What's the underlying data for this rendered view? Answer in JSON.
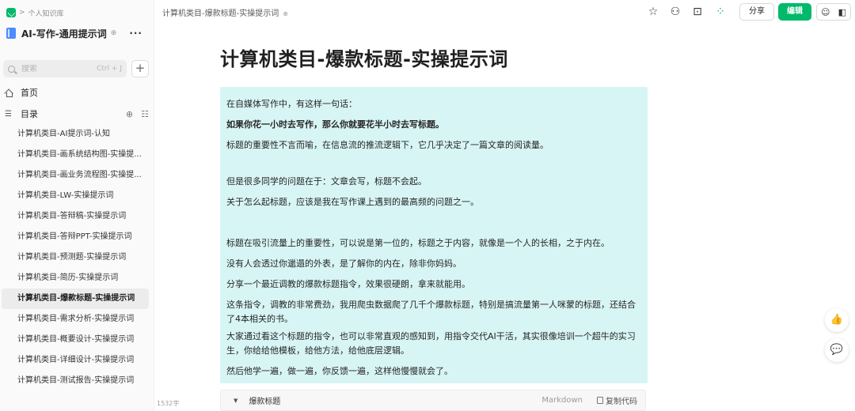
{
  "breadcrumb": {
    "separator": ">",
    "label": "个人知识库"
  },
  "knowledge_base": {
    "title": "AI-写作-通用提示词",
    "share_glyph": "⊕",
    "more_glyph": "···"
  },
  "search": {
    "placeholder": "搜索",
    "shortcut": "Ctrl + J"
  },
  "add_button": {
    "label": "+"
  },
  "nav": {
    "home": "首页",
    "toc": "目录"
  },
  "doc_list": [
    {
      "label": "计算机类目-AI提示词-认知",
      "active": false
    },
    {
      "label": "计算机类目-画系统结构图-实操提...",
      "active": false
    },
    {
      "label": "计算机类目-画业务流程图-实操提...",
      "active": false
    },
    {
      "label": "计算机类目-LW-实操提示词",
      "active": false
    },
    {
      "label": "计算机类目-答辩稿-实操提示词",
      "active": false
    },
    {
      "label": "计算机类目-答辩PPT-实操提示词",
      "active": false
    },
    {
      "label": "计算机类目-预测题-实操提示词",
      "active": false
    },
    {
      "label": "计算机类目-简历-实操提示词",
      "active": false
    },
    {
      "label": "计算机类目-爆款标题-实操提示词",
      "active": true
    },
    {
      "label": "计算机类目-需求分析-实操提示词",
      "active": false
    },
    {
      "label": "计算机类目-概要设计-实操提示词",
      "active": false
    },
    {
      "label": "计算机类目-详细设计-实操提示词",
      "active": false
    },
    {
      "label": "计算机类目-测试报告-实操提示词",
      "active": false
    }
  ],
  "word_count": "1532字",
  "topbar": {
    "doc_title": "计算机类目-爆款标题-实操提示词",
    "share_glyph": "⊕",
    "share_button": "分享",
    "edit_button": "编辑"
  },
  "page": {
    "title": "计算机类目-爆款标题-实操提示词",
    "paragraphs": [
      "在自媒体写作中，有这样一句话：",
      "如果你花一小时去写作，那么你就要花半小时去写标题。",
      "标题的重要性不言而喻，在信息流的推流逻辑下，它几乎决定了一篇文章的阅读量。",
      "但是很多同学的问题在于：文章会写，标题不会起。",
      "关于怎么起标题，应该是我在写作课上遇到的最高频的问题之一。",
      "标题在吸引流量上的重要性，可以说是第一位的，标题之于内容，就像是一个人的长相，之于内在。",
      "没有人会透过你邋遢的外表，是了解你的内在，除非你妈妈。",
      "分享一个最近调教的爆款标题指令，效果很硬朗，拿来就能用。",
      "这条指令，调教的非常费劲，我用爬虫数据爬了几千个爆款标题，特别是搞流量第一人咪蒙的标题，还结合了4本相关的书。",
      "大家通过看这个标题的指令，也可以非常直观的感知到，用指令交代AI干活，其实很像培训一个超牛的实习生，你给给他模板，给他方法，给他底层逻辑。",
      "然后他学一遍，做一遍，你反馈一遍，这样他慢慢就会了。"
    ]
  },
  "code_block": {
    "title": "爆款标题",
    "language": "Markdown",
    "copy_label": "复制代码"
  },
  "colors": {
    "accent": "#00b96b",
    "highlight_bg": "#d8f5f5",
    "sidebar_bg": "#fafafa"
  }
}
